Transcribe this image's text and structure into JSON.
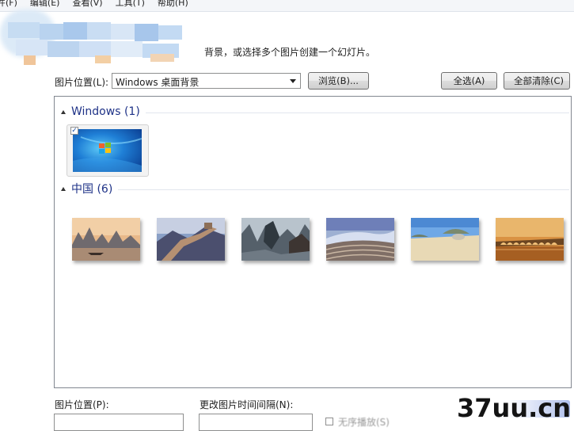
{
  "menu": {
    "items": [
      "件(F)",
      "编辑(E)",
      "查看(V)",
      "工具(T)",
      "帮助(H)"
    ]
  },
  "instruction": "背景，或选择多个图片创建一个幻灯片。",
  "location": {
    "label": "图片位置(L):",
    "selected": "Windows 桌面背景",
    "browse_label": "浏览(B)...",
    "select_all_label": "全选(A)",
    "clear_all_label": "全部清除(C)"
  },
  "groups": [
    {
      "title": "Windows (1)"
    },
    {
      "title": "中国 (6)"
    }
  ],
  "selected_checkbox": "✓",
  "bottom": {
    "position_label": "图片位置(P):",
    "interval_label": "更改图片时间间隔(N):",
    "shuffle_label": "无序播放(S)"
  },
  "watermark": "37uu.cn",
  "colors": {
    "group_title": "#1e3287",
    "panel_border": "#828790"
  }
}
